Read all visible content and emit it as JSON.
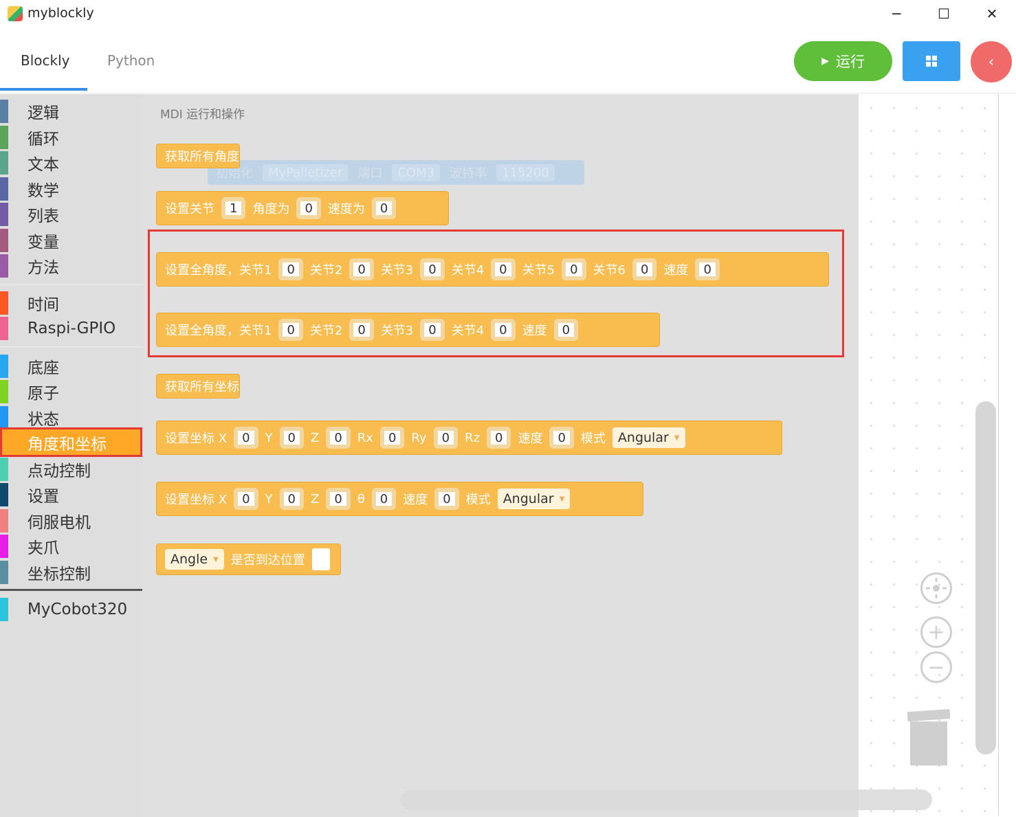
{
  "window": {
    "title": "myblockly",
    "controls": [
      "─",
      "☐",
      "✕"
    ]
  },
  "header": {
    "tabs": [
      {
        "label": "Blockly",
        "active": true
      },
      {
        "label": "Python",
        "active": false
      }
    ],
    "run_label": "运行",
    "colors": {
      "run": "#5fbf3a",
      "grid": "#3aa0f0",
      "back": "#f06a6a"
    }
  },
  "toolbox": {
    "group1": [
      {
        "label": "逻辑",
        "color": "#5b80a5"
      },
      {
        "label": "循环",
        "color": "#5ba55b"
      },
      {
        "label": "文本",
        "color": "#5ba58c"
      },
      {
        "label": "数学",
        "color": "#5b67a5"
      },
      {
        "label": "列表",
        "color": "#745ba5"
      },
      {
        "label": "变量",
        "color": "#a55b80"
      },
      {
        "label": "方法",
        "color": "#995ba5"
      }
    ],
    "group2": [
      {
        "label": "时间",
        "color": "#ff5722"
      },
      {
        "label": "Raspi-GPIO",
        "color": "#f06292"
      }
    ],
    "group3": [
      {
        "label": "底座",
        "color": "#29a8f2"
      },
      {
        "label": "原子",
        "color": "#7ed321"
      },
      {
        "label": "状态",
        "color": "#2196f3"
      },
      {
        "label": "角度和坐标",
        "color": "#ffa726",
        "selected": true
      },
      {
        "label": "点动控制",
        "color": "#4dd0b1"
      },
      {
        "label": "设置",
        "color": "#0d4a6e"
      },
      {
        "label": "伺服电机",
        "color": "#f08080"
      },
      {
        "label": "夹爪",
        "color": "#e91ee6"
      },
      {
        "label": "坐标控制",
        "color": "#5a8fa0"
      }
    ],
    "group4": [
      {
        "label": "MyCobot320",
        "color": "#2ac4dc"
      }
    ]
  },
  "flyout": {
    "title": "MDI 运行和操作",
    "ghost": {
      "init": "初始化",
      "robot": "MyPalletizer",
      "port_label": "端口",
      "port": "COM3",
      "baud_label": "波特率",
      "baud": "115200"
    },
    "b_get_angles": "获取所有角度",
    "b_set_joint": {
      "label": "设置关节",
      "joint": "1",
      "angle_label": "角度为",
      "angle": "0",
      "speed_label": "速度为",
      "speed": "0"
    },
    "b_all6": {
      "label": "设置全角度，关节1",
      "j1": "0",
      "j2l": "关节2",
      "j2": "0",
      "j3l": "关节3",
      "j3": "0",
      "j4l": "关节4",
      "j4": "0",
      "j5l": "关节5",
      "j5": "0",
      "j6l": "关节6",
      "j6": "0",
      "spl": "速度",
      "sp": "0"
    },
    "b_all4": {
      "label": "设置全角度，关节1",
      "j1": "0",
      "j2l": "关节2",
      "j2": "0",
      "j3l": "关节3",
      "j3": "0",
      "j4l": "关节4",
      "j4": "0",
      "spl": "速度",
      "sp": "0"
    },
    "b_get_coords": "获取所有坐标",
    "b_coords6": {
      "label": "设置坐标 X",
      "x": "0",
      "yl": "Y",
      "y": "0",
      "zl": "Z",
      "z": "0",
      "rxl": "Rx",
      "rx": "0",
      "ryl": "Ry",
      "ry": "0",
      "rzl": "Rz",
      "rz": "0",
      "spl": "速度",
      "sp": "0",
      "model": "模式",
      "mode": "Angular"
    },
    "b_coords4": {
      "label": "设置坐标 X",
      "x": "0",
      "yl": "Y",
      "y": "0",
      "zl": "Z",
      "z": "0",
      "tl": "θ",
      "t": "0",
      "spl": "速度",
      "sp": "0",
      "model": "模式",
      "mode": "Angular"
    },
    "b_reached": {
      "mode": "Angle",
      "label": "是否到达位置"
    }
  }
}
